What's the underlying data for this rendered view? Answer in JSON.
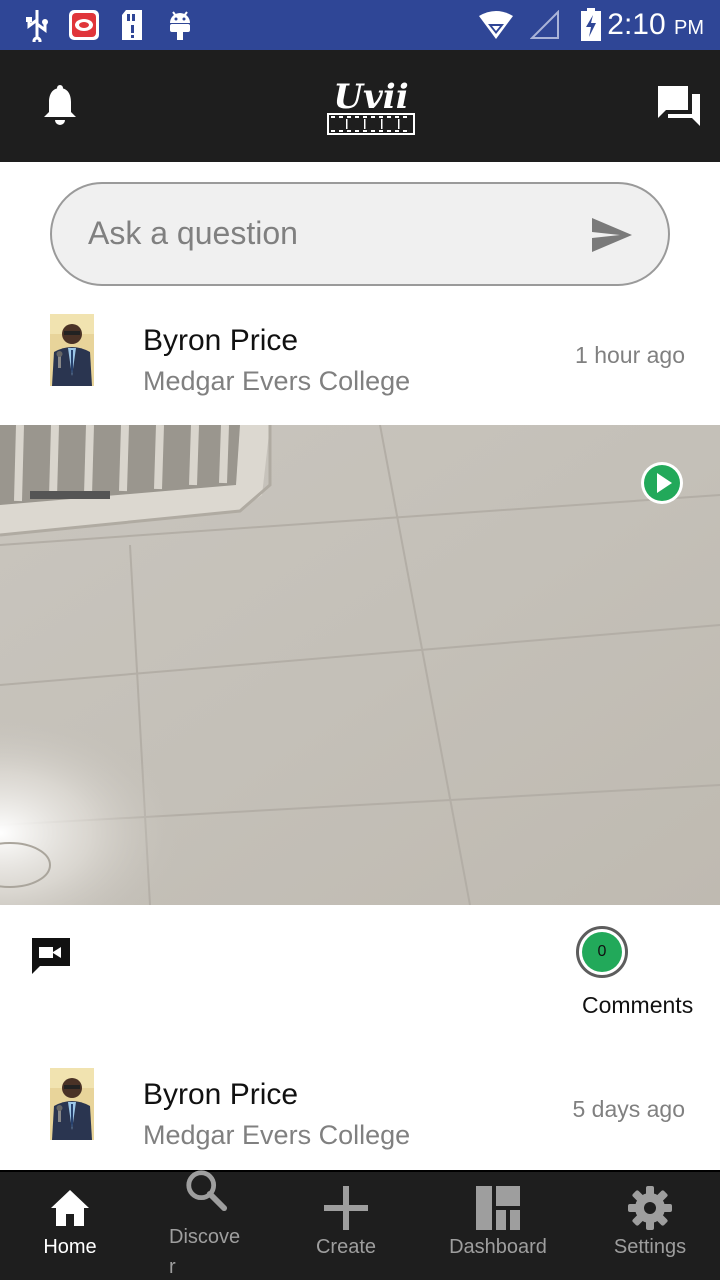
{
  "status_bar": {
    "time": "2:10",
    "ampm": "PM",
    "icons": [
      "usb-icon",
      "app-notification-icon",
      "sd-card-icon",
      "android-icon",
      "wifi-icon",
      "signal-icon",
      "battery-charging-icon"
    ]
  },
  "app_bar": {
    "logo_text": "Uvii",
    "icons": [
      "bell-icon",
      "chat-icon"
    ]
  },
  "ask": {
    "placeholder": "Ask a question"
  },
  "posts": [
    {
      "author": "Byron Price",
      "school": "Medgar Evers College",
      "time_ago": "1 hour ago",
      "comments_count": "0",
      "comments_label": "Comments"
    },
    {
      "author": "Byron Price",
      "school": "Medgar Evers College",
      "time_ago": "5 days ago"
    }
  ],
  "bottom_nav": {
    "items": [
      {
        "label": "Home",
        "icon": "home-icon",
        "active": true
      },
      {
        "label": "Discover",
        "icon": "search-icon",
        "active": false
      },
      {
        "label": "Create",
        "icon": "plus-icon",
        "active": false
      },
      {
        "label": "Dashboard",
        "icon": "dashboard-icon",
        "active": false
      },
      {
        "label": "Settings",
        "icon": "gear-icon",
        "active": false
      }
    ]
  },
  "colors": {
    "status_bar": "#2f4696",
    "app_bar": "#1e1e1e",
    "accent_green": "#22a95a"
  }
}
